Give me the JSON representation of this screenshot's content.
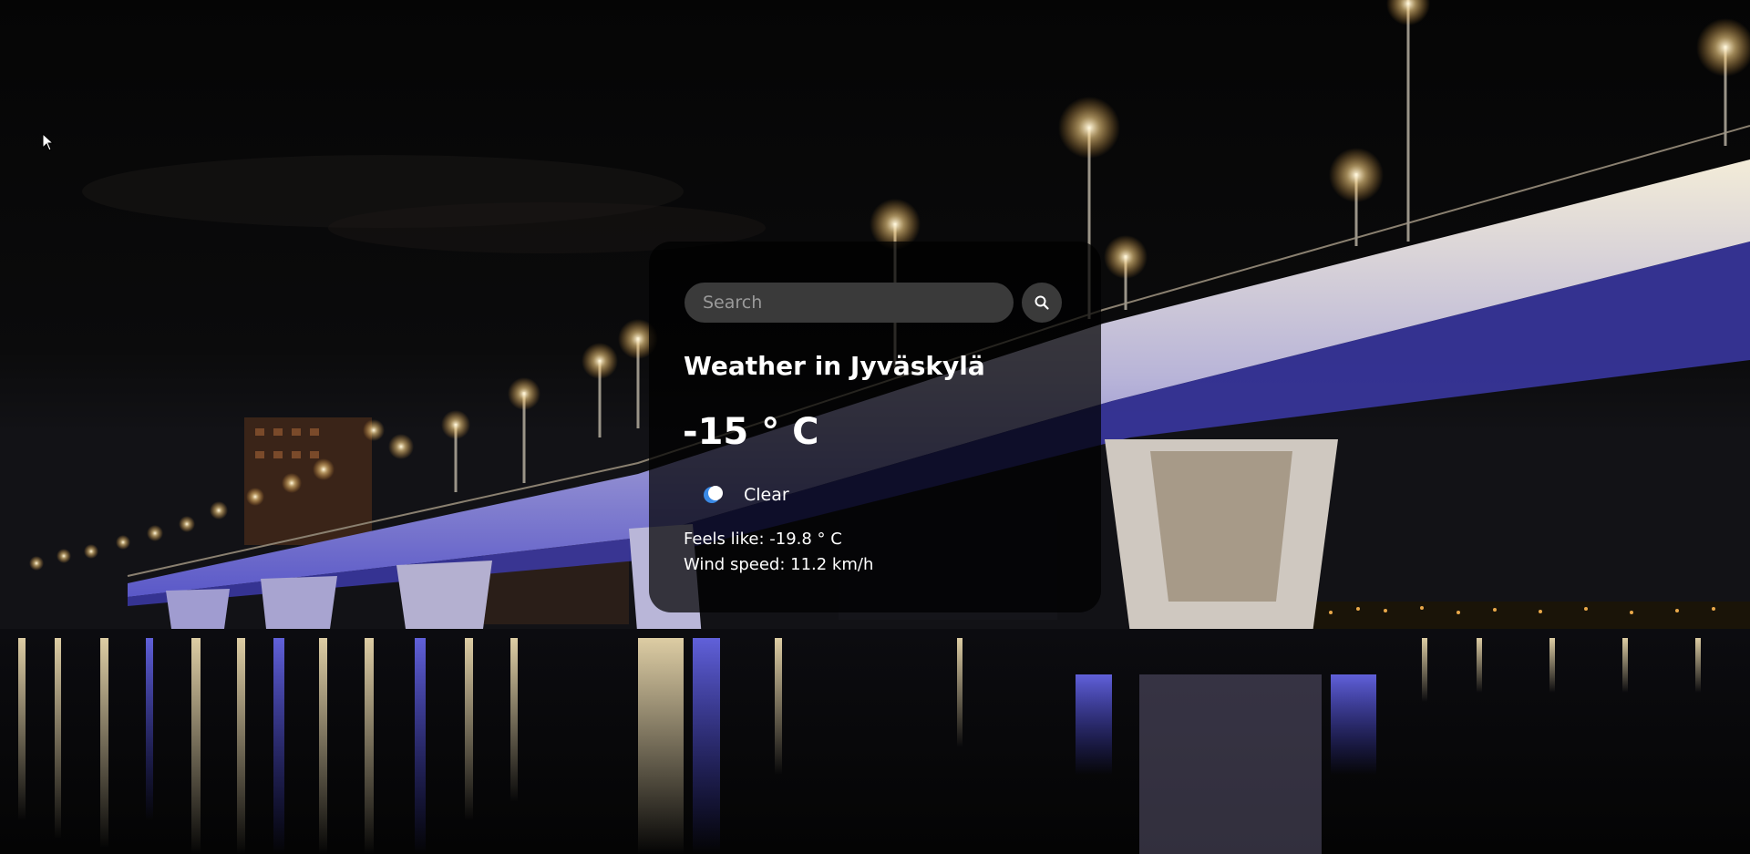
{
  "search": {
    "placeholder": "Search",
    "value": "",
    "icon": "search-icon"
  },
  "weather": {
    "title": "Weather in Jyväskylä",
    "temperature": "-15 ° C",
    "condition_icon": "moon-icon",
    "condition": "Clear",
    "feels_like": "Feels like: -19.8 ° C",
    "wind_speed": "Wind speed: 11.2 km/h"
  },
  "colors": {
    "card_background": "#000000",
    "input_background": "#3a3a3a",
    "text": "#ffffff",
    "moon_accent": "#3b8ae6"
  }
}
